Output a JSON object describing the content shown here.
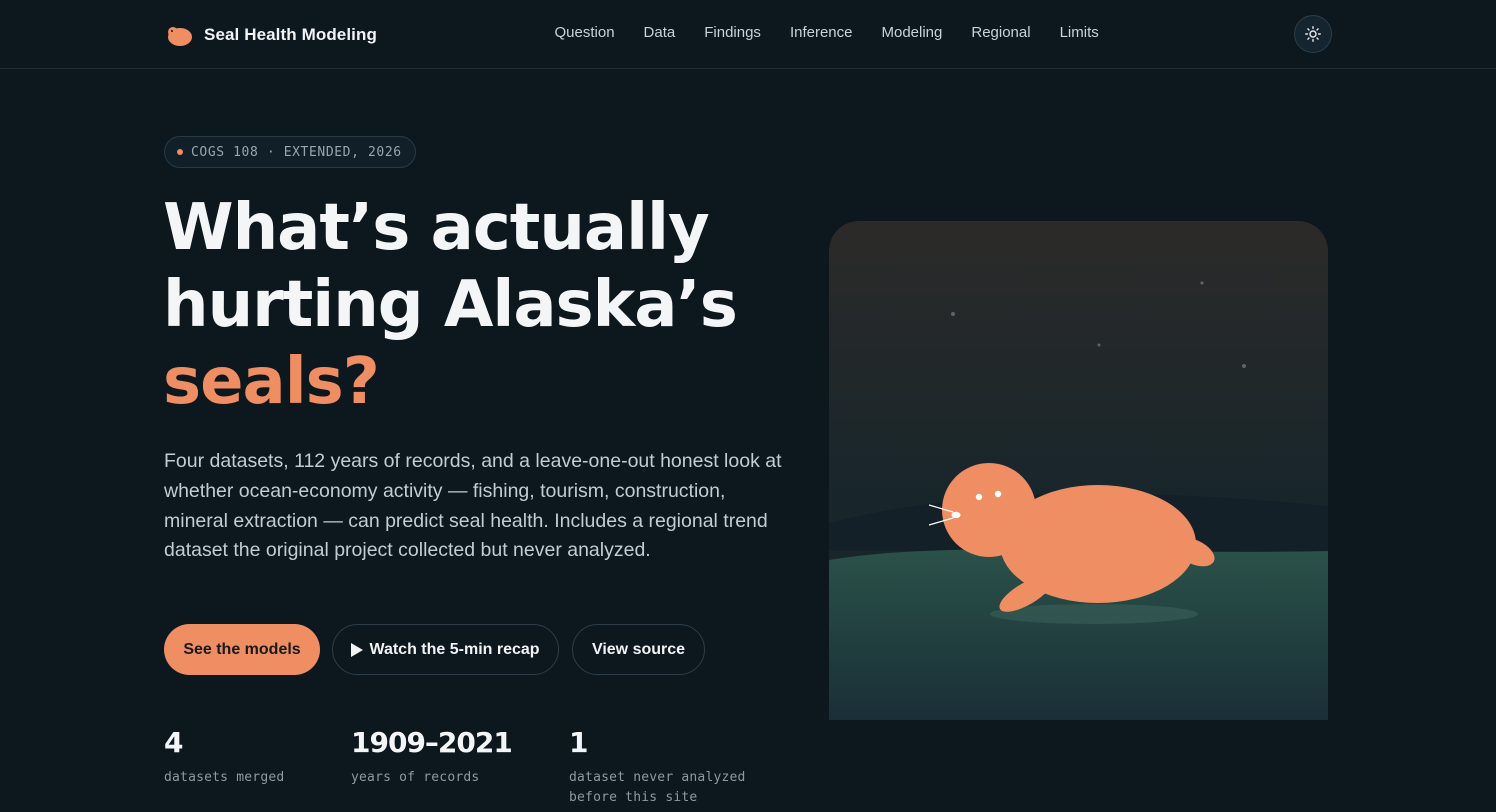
{
  "brand": {
    "name": "Seal Health Modeling",
    "logo_icon": "seal-logo-icon"
  },
  "nav": {
    "links": [
      {
        "label": "Question"
      },
      {
        "label": "Data"
      },
      {
        "label": "Findings"
      },
      {
        "label": "Inference"
      },
      {
        "label": "Modeling"
      },
      {
        "label": "Regional"
      },
      {
        "label": "Limits"
      }
    ],
    "theme_toggle_icon": "sun-icon"
  },
  "hero": {
    "badge": "COGS 108 · EXTENDED, 2026",
    "headline_line1": "What’s actually",
    "headline_line2": "hurting Alaska’s",
    "headline_accent": "seals?",
    "lede": "Four datasets, 112 years of records, and a leave-one-out honest look at whether ocean-economy activity — fishing, tourism, construction, mineral extraction — can predict seal health. Includes a regional trend dataset the original project collected but never analyzed.",
    "buttons": {
      "primary": "See the models",
      "recap": "Watch the 5-min recap",
      "source": "View source"
    },
    "stats": [
      {
        "value": "4",
        "label": "datasets merged"
      },
      {
        "value": "1909–2021",
        "label": "years of records"
      },
      {
        "value": "1",
        "label": "dataset never analyzed before this site"
      }
    ]
  },
  "colors": {
    "background": "#0c171e",
    "accent": "#ef8d63",
    "text": "#f4f5f6"
  },
  "illustration": "seal-illustration"
}
